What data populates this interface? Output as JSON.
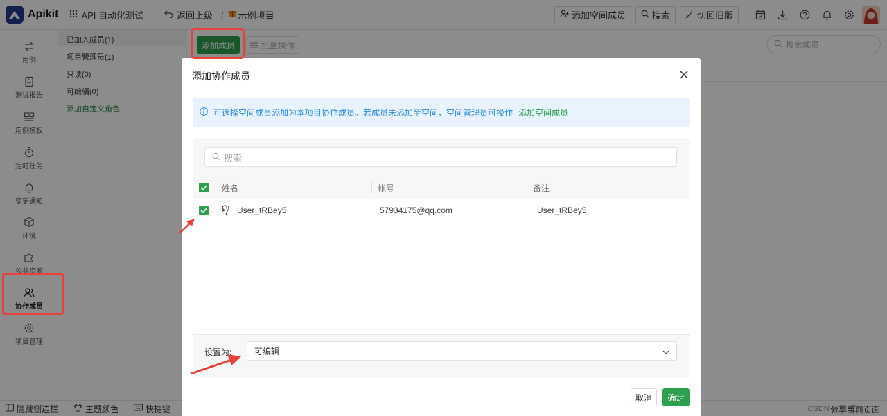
{
  "app": {
    "name": "Apikit"
  },
  "topbar": {
    "project_group": "API 自动化测试",
    "back": "返回上级",
    "project": "示例项目",
    "add_space_member": "添加空间成员",
    "search": "搜索",
    "switch_old": "切回旧版"
  },
  "sidebar": {
    "items": [
      {
        "label": "用例",
        "icon": "swap-icon"
      },
      {
        "label": "测试报告",
        "icon": "report-icon"
      },
      {
        "label": "用例模板",
        "icon": "template-icon"
      },
      {
        "label": "定时任务",
        "icon": "timer-icon"
      },
      {
        "label": "变更通知",
        "icon": "bell-icon"
      },
      {
        "label": "环境",
        "icon": "cube-icon"
      },
      {
        "label": "公共资源",
        "icon": "puzzle-icon"
      },
      {
        "label": "协作成员",
        "icon": "users-icon",
        "active": true
      },
      {
        "label": "项目管理",
        "icon": "gear-icon"
      }
    ]
  },
  "roles": {
    "items": [
      "已加入成员(1)",
      "项目管理员(1)",
      "只读(0)",
      "可编辑(0)"
    ],
    "add_custom": "添加自定义角色"
  },
  "main": {
    "add_member": "添加成员",
    "batch": "批量操作",
    "search_placeholder": "搜索成员"
  },
  "modal": {
    "title": "添加协作成员",
    "notice": "可选择空间成员添加为本项目协作成员。若成员未添加至空间，空间管理员可操作",
    "notice_link": "添加空间成员",
    "search_placeholder": "搜索",
    "columns": [
      "姓名",
      "帐号",
      "备注"
    ],
    "rows": [
      {
        "name": "User_tRBey5",
        "account": "57934175@qq.com",
        "note": "User_tRBey5",
        "checked": true
      }
    ],
    "set_to_label": "设置为:",
    "set_to_value": "可编辑",
    "cancel": "取消",
    "confirm": "确定"
  },
  "bottombar": {
    "hide_sidebar": "隐藏侧边栏",
    "theme": "主题颜色",
    "shortcuts": "快捷键",
    "share": "分享当前页面",
    "watermark": "CSDN @鹏 匠"
  },
  "colors": {
    "accent": "#2e9e4f",
    "highlight": "#e8413b",
    "brand": "#233b8f"
  }
}
